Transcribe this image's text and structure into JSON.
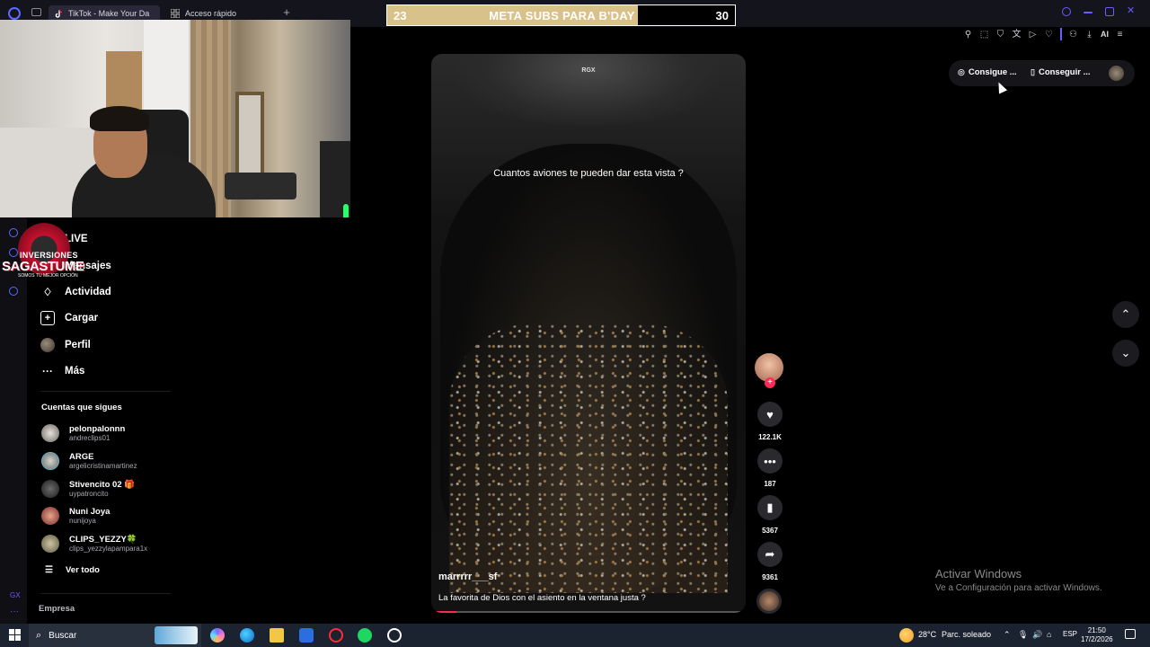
{
  "browser": {
    "tabs": [
      {
        "label": "TikTok - Make Your Da",
        "active": true,
        "icon": "tiktok-icon"
      },
      {
        "label": "Acceso rápido",
        "active": false,
        "icon": "grid-icon"
      }
    ],
    "new_tab_label": "+",
    "toolbar_ai_label": "AI"
  },
  "goal_overlay": {
    "start": "23",
    "title": "META SUBS PARA B'DAY",
    "end": "30",
    "progress_fraction": 0.72,
    "fill_color": "#d9c18a"
  },
  "logo": {
    "line1": "INVERSIONES",
    "line2": "SAGASTUME",
    "line3": "SOMOS TU MEJOR OPCIÓN"
  },
  "sidebar": {
    "nav": [
      {
        "label": "LIVE",
        "icon": "live-icon"
      },
      {
        "label": "Mensajes",
        "icon": "message-icon"
      },
      {
        "label": "Actividad",
        "icon": "activity-icon"
      },
      {
        "label": "Cargar",
        "icon": "upload-icon"
      },
      {
        "label": "Perfil",
        "icon": "profile-icon"
      },
      {
        "label": "Más",
        "icon": "more-icon"
      }
    ],
    "following_title": "Cuentas que sigues",
    "following": [
      {
        "name": "pelonpalonnn",
        "handle": "andreclips01"
      },
      {
        "name": "ARGE",
        "handle": "argelicristinamartinez"
      },
      {
        "name": "Stivencito 02 🎁",
        "handle": "uypatroncito"
      },
      {
        "name": "Nuni Joya",
        "handle": "nunijoya"
      },
      {
        "name": "CLIPS_YEZZY🍀",
        "handle": "clips_yezzylapampara1x"
      }
    ],
    "see_all": "Ver todo",
    "company": "Empresa"
  },
  "video": {
    "watermark": "RGX",
    "caption": "Cuantos aviones te pueden dar esta vista ?",
    "author": "marrrrr___sf",
    "description": "La favorita de Dios con el asiento en la ventana justa  ?",
    "progress_fraction": 0.07,
    "progress_color": "#fe2c55"
  },
  "actions": {
    "follow_symbol": "+",
    "likes": "122.1K",
    "comments": "187",
    "saves": "5367",
    "shares": "9361"
  },
  "topright": {
    "get_coins": "Consigue ...",
    "get_app": "Conseguir ..."
  },
  "windows_watermark": {
    "title": "Activar Windows",
    "subtitle": "Ve a Configuración para activar Windows."
  },
  "taskbar": {
    "search_placeholder": "Buscar",
    "weather_temp": "28°C",
    "weather_desc": "Parc. soleado",
    "lang": "ESP",
    "time": "21:50",
    "date": "17/2/2026"
  },
  "rail": {
    "gx_label": "GX",
    "more": "···"
  }
}
